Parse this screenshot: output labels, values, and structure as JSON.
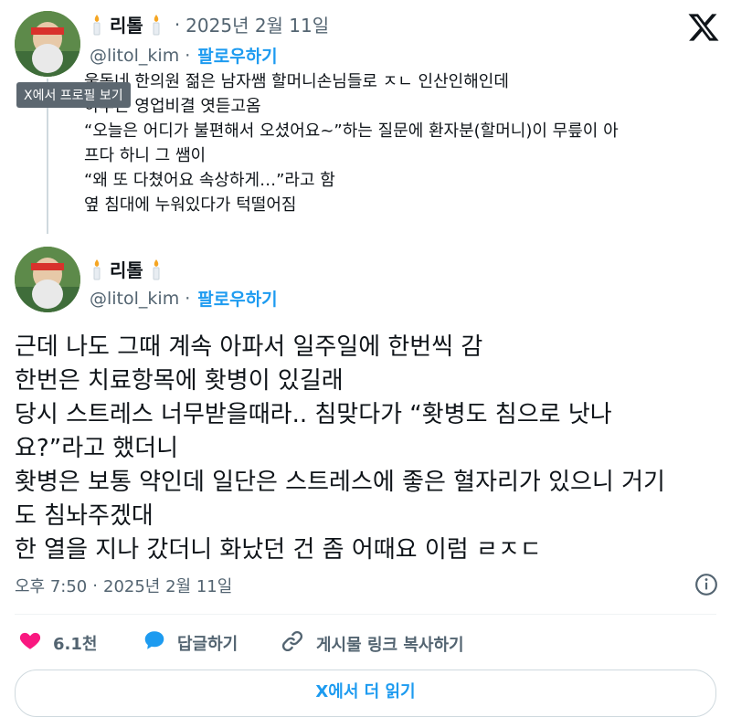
{
  "parent_tweet": {
    "name": "리톨",
    "separator": "·",
    "date": "2025년 2월 11일",
    "handle": "@litol_kim",
    "follow_label": "팔로우하기",
    "tooltip": "X에서 프로필 보기",
    "lines": [
      "울동네 한의원 젊은 남자쌤 할머니손님들로 ㅈㄴ 인산인해인데",
      "하루는 영업비결 엿듣고옴",
      "“오늘은 어디가 불편해서 오셨어요~”하는 질문에 환자분(할머니)이 무릎이 아",
      "프다 하니 그 쌤이",
      "“왜 또 다쳤어요 속상하게…”라고 함",
      "옆 침대에 누워있다가 턱떨어짐"
    ]
  },
  "main_tweet": {
    "name": "리톨",
    "handle": "@litol_kim",
    "separator": "·",
    "follow_label": "팔로우하기",
    "lines": [
      "근데 나도 그때 계속 아파서 일주일에 한번씩 감",
      "한번은 치료항목에 홧병이 있길래",
      "당시 스트레스 너무받을때라.. 침맞다가 “홧병도 침으로 낫나",
      "요?”라고 했더니",
      "홧병은 보통 약인데 일단은 스트레스에 좋은 혈자리가 있으니 거기",
      "도 침놔주겠대",
      "한 열을 지나 갔더니 화났던 건 좀 어때요 이럼 ㄹㅈㄷ"
    ],
    "time": "오후 7:50",
    "date": "2025년 2월 11일"
  },
  "actions": {
    "like_count": "6.1천",
    "reply_label": "답글하기",
    "copy_link_label": "게시물 링크 복사하기"
  },
  "read_more_label": "X에서 더 읽기",
  "colors": {
    "accent": "#1d9bf0",
    "like": "#f91880",
    "text": "#0f1419",
    "muted": "#536471"
  },
  "icons": [
    "x-logo-icon",
    "candle-icon",
    "info-icon",
    "heart-icon",
    "reply-bubble-icon",
    "link-icon"
  ]
}
